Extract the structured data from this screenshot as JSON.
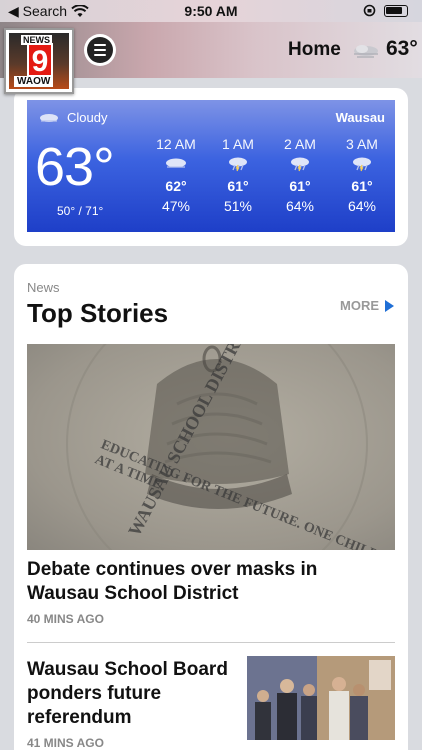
{
  "status_bar": {
    "back_label": "◀ Search",
    "time": "9:50 AM"
  },
  "header": {
    "logo_news": "NEWS",
    "logo_number": "9",
    "logo_station": "WAOW",
    "home_label": "Home",
    "temp": "63°"
  },
  "weather": {
    "condition": "Cloudy",
    "location": "Wausau",
    "current_temp": "63°",
    "range": "50° / 71°",
    "hours": [
      {
        "time": "12 AM",
        "temp": "62°",
        "precip": "47%",
        "icon": "cloud-icon"
      },
      {
        "time": "1 AM",
        "temp": "61°",
        "precip": "51%",
        "icon": "thunderstorm-icon"
      },
      {
        "time": "2 AM",
        "temp": "61°",
        "precip": "64%",
        "icon": "thunderstorm-icon"
      },
      {
        "time": "3 AM",
        "temp": "61°",
        "precip": "64%",
        "icon": "thunderstorm-icon"
      }
    ]
  },
  "news": {
    "section_label": "News",
    "title": "Top Stories",
    "more_label": "MORE",
    "stories": [
      {
        "headline": "Debate continues over masks in Wausau School District",
        "time": "40 MINS AGO"
      },
      {
        "headline": "Wausau School Board ponders future referendum",
        "time": "41 MINS AGO"
      }
    ],
    "hero_image_text": {
      "top": "WAUSAU SCHOOL DISTRICT",
      "bottom": "EDUCATING FOR THE FUTURE. ONE CHILD AT A TIME."
    }
  }
}
